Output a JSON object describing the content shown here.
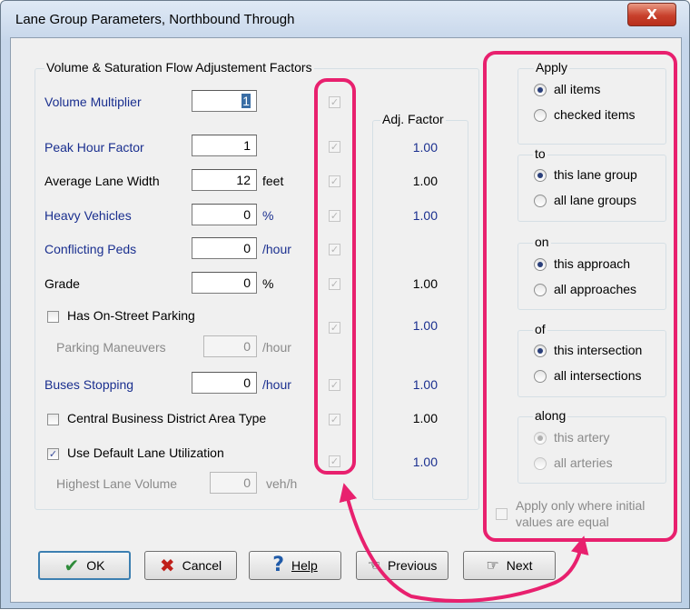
{
  "window": {
    "title": "Lane Group Parameters, Northbound Through",
    "close_glyph": "X"
  },
  "factors_group": {
    "label": "Volume & Saturation Flow Adjustement Factors",
    "adj_header": "Adj. Factor",
    "rows": {
      "volume_multiplier": {
        "label": "Volume Multiplier",
        "value": "1",
        "unit": "",
        "adj": ""
      },
      "peak_hour_factor": {
        "label": "Peak Hour Factor",
        "value": "1",
        "unit": "",
        "adj": "1.00"
      },
      "average_lane_width": {
        "label": "Average Lane Width",
        "value": "12",
        "unit": "feet",
        "adj": "1.00"
      },
      "heavy_vehicles": {
        "label": "Heavy Vehicles",
        "value": "0",
        "unit": "%",
        "adj": "1.00"
      },
      "conflicting_peds": {
        "label": "Conflicting Peds",
        "value": "0",
        "unit": "/hour",
        "adj": ""
      },
      "grade": {
        "label": "Grade",
        "value": "0",
        "unit": "%",
        "adj": "1.00"
      },
      "has_on_street_parking": {
        "label": "Has On-Street Parking",
        "adj": "1.00"
      },
      "parking_maneuvers": {
        "label": "Parking Maneuvers",
        "value": "0",
        "unit": "/hour"
      },
      "buses_stopping": {
        "label": "Buses Stopping",
        "value": "0",
        "unit": "/hour",
        "adj": "1.00"
      },
      "cbd_area_type": {
        "label": "Central Business District Area Type",
        "adj": "1.00"
      },
      "use_default_lane_utilization": {
        "label": "Use Default Lane Utilization",
        "adj": "1.00"
      },
      "highest_lane_volume": {
        "label": "Highest Lane Volume",
        "value": "0",
        "unit": "veh/h"
      }
    }
  },
  "apply_panel": {
    "apply": {
      "label": "Apply",
      "options": [
        "all items",
        "checked items"
      ],
      "selected": "all items"
    },
    "to": {
      "label": "to",
      "options": [
        "this lane group",
        "all lane groups"
      ],
      "selected": "this lane group"
    },
    "on": {
      "label": "on",
      "options": [
        "this approach",
        "all approaches"
      ],
      "selected": "this approach"
    },
    "of": {
      "label": "of",
      "options": [
        "this intersection",
        "all intersections"
      ],
      "selected": "this intersection"
    },
    "along": {
      "label": "along",
      "options": [
        "this artery",
        "all arteries"
      ],
      "selected": "this artery"
    },
    "apply_only_equal": {
      "line1": "Apply only where initial",
      "line2": "values are equal"
    }
  },
  "buttons": {
    "ok": "OK",
    "cancel": "Cancel",
    "help": "Help",
    "previous": "Previous",
    "next": "Next"
  },
  "colors": {
    "highlight": "#e8206e",
    "blue_label": "#1a2f8f"
  }
}
